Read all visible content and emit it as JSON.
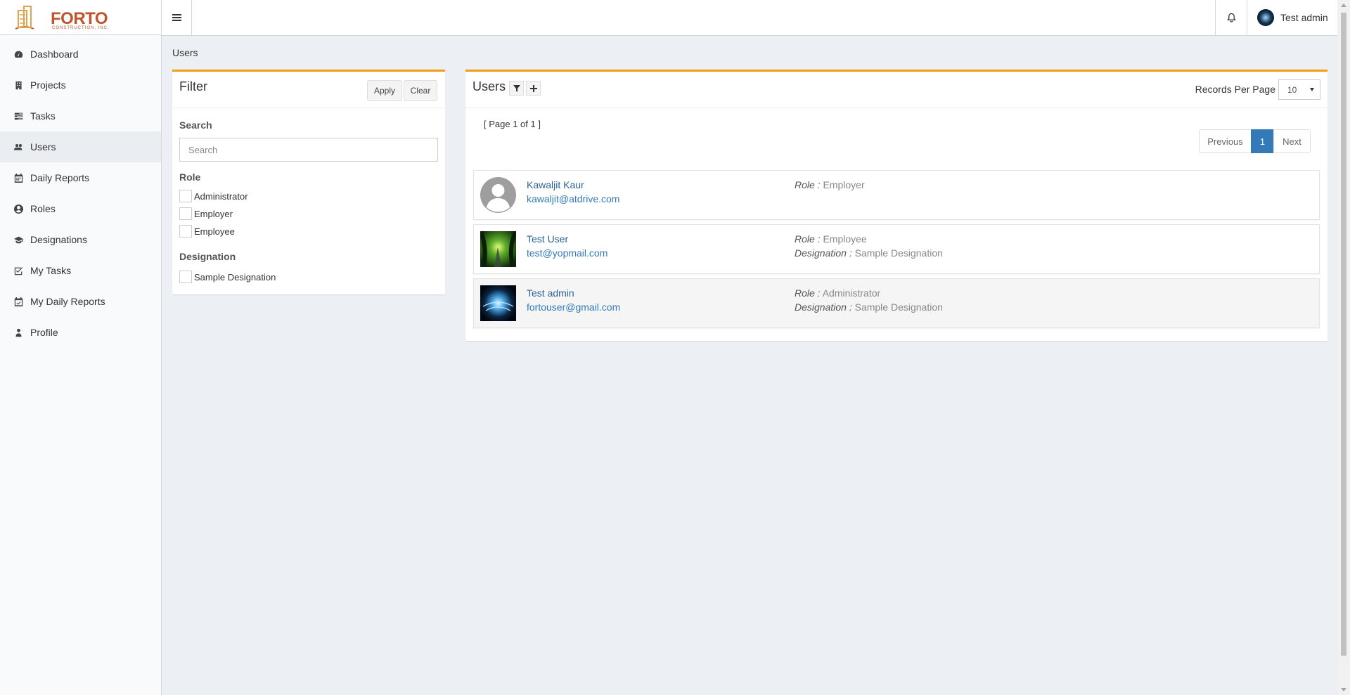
{
  "app": {
    "logo_text": "FORTO",
    "logo_sub": "CONSTRUCTION, INC.",
    "header_user": "Test admin"
  },
  "sidebar": {
    "items": [
      {
        "label": "Dashboard",
        "icon": "dashboard-icon"
      },
      {
        "label": "Projects",
        "icon": "building-icon"
      },
      {
        "label": "Tasks",
        "icon": "tasks-icon"
      },
      {
        "label": "Users",
        "icon": "users-icon",
        "active": true
      },
      {
        "label": "Daily Reports",
        "icon": "calendar-icon"
      },
      {
        "label": "Roles",
        "icon": "user-circle-icon"
      },
      {
        "label": "Designations",
        "icon": "graduation-cap-icon"
      },
      {
        "label": "My Tasks",
        "icon": "check-square-icon"
      },
      {
        "label": "My Daily Reports",
        "icon": "calendar-check-icon"
      },
      {
        "label": "Profile",
        "icon": "user-icon"
      }
    ]
  },
  "breadcrumb": "Users",
  "filter": {
    "title": "Filter",
    "apply_label": "Apply",
    "clear_label": "Clear",
    "search_label": "Search",
    "search_placeholder": "Search",
    "search_value": "",
    "role_label": "Role",
    "roles": [
      "Administrator",
      "Employer",
      "Employee"
    ],
    "designation_label": "Designation",
    "designations": [
      "Sample Designation"
    ]
  },
  "users_panel": {
    "title": "Users",
    "records_per_page_label": "Records Per Page",
    "records_per_page_value": "10",
    "page_info": "[ Page 1 of 1 ]",
    "pager": {
      "previous": "Previous",
      "current": "1",
      "next": "Next"
    },
    "role_key": "Role :",
    "designation_key": "Designation :",
    "users": [
      {
        "name": "Kawaljit Kaur",
        "email": "kawaljit@atdrive.com",
        "role": "Employer",
        "designation": "",
        "avatar": "default-avatar"
      },
      {
        "name": "Test User",
        "email": "test@yopmail.com",
        "role": "Employee",
        "designation": "Sample Designation",
        "avatar": "green-forest-photo"
      },
      {
        "name": "Test admin",
        "email": "fortouser@gmail.com",
        "role": "Administrator",
        "designation": "Sample Designation",
        "avatar": "blue-light-photo"
      }
    ]
  },
  "colors": {
    "accent": "#f39c12",
    "link": "#337ab7",
    "pager_active": "#337ab7",
    "logo": "#c0542f"
  }
}
